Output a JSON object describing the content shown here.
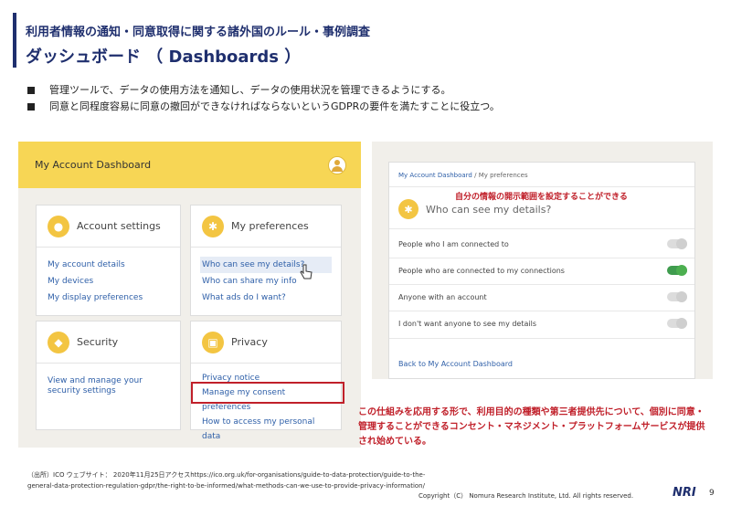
{
  "header": {
    "subtitle": "利用者情報の通知・同意取得に関する諸外国のルール・事例調査",
    "title": "ダッシュボード （ Dashboards ）"
  },
  "bullets": [
    "管理ツールで、データの使用方法を通知し、データの使用状況を管理できるようにする。",
    "同意と同程度容易に同意の撤回ができなければならないというGDPRの要件を満たすことに役立つ。"
  ],
  "dashboard": {
    "title": "My Account Dashboard",
    "cards": [
      {
        "title": "Account settings",
        "links": [
          "My account details",
          "My devices",
          "My display preferences"
        ]
      },
      {
        "title": "My preferences",
        "links": [
          "Who can see my details?",
          "Who can share my info",
          "What ads do I want?"
        ]
      },
      {
        "title": "Security",
        "links": [
          "View and manage your security settings"
        ]
      },
      {
        "title": "Privacy",
        "links": [
          "Privacy notice",
          "Manage my consent preferences",
          "How to access my personal data"
        ]
      }
    ]
  },
  "preferences": {
    "breadcrumb_link": "My Account Dashboard",
    "breadcrumb_sep": " / ",
    "breadcrumb_current": "My preferences",
    "annotation": "自分の情報の開示範囲を設定することができる",
    "question": "Who can see my details?",
    "options": [
      {
        "label": "People who I am connected to",
        "on": false
      },
      {
        "label": "People who are connected to my connections",
        "on": true
      },
      {
        "label": "Anyone with an account",
        "on": false
      },
      {
        "label": "I don't want anyone to see my details",
        "on": false
      }
    ],
    "back_link": "Back to My Account Dashboard"
  },
  "note": "この仕組みを応用する形で、利用目的の種類や第三者提供先について、個別に同意・管理することができるコンセント・マネジメント・プラットフォームサービスが提供され始めている。",
  "source": "（出所）ICO ウェブサイト： 2020年11月25日アクセスhttps://ico.org.uk/for-organisations/guide-to-data-protection/guide-to-the-general-data-protection-regulation-gdpr/the-right-to-be-informed/what-methods-can-we-use-to-provide-privacy-information/",
  "footer": {
    "copyright": "Copyright（C） Nomura Research Institute, Ltd. All rights reserved.",
    "logo": "NRI",
    "page": "9"
  },
  "colors": {
    "accent": "#1f2f6e",
    "highlight_red": "#c0202a",
    "dashboard_yellow": "#f7d655"
  }
}
